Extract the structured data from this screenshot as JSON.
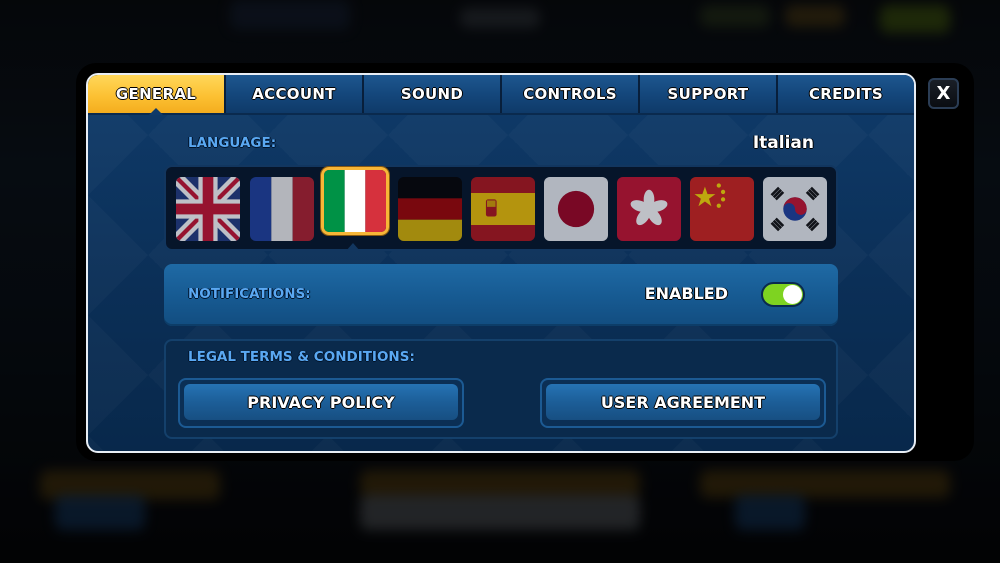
{
  "tabs": [
    {
      "label": "GENERAL",
      "active": true
    },
    {
      "label": "ACCOUNT",
      "active": false
    },
    {
      "label": "SOUND",
      "active": false
    },
    {
      "label": "CONTROLS",
      "active": false
    },
    {
      "label": "SUPPORT",
      "active": false
    },
    {
      "label": "CREDITS",
      "active": false
    }
  ],
  "close_label": "X",
  "language": {
    "label": "LANGUAGE:",
    "selected": "Italian",
    "flags": [
      {
        "name": "uk-flag",
        "language": "English"
      },
      {
        "name": "france-flag",
        "language": "French"
      },
      {
        "name": "italy-flag",
        "language": "Italian"
      },
      {
        "name": "germany-flag",
        "language": "German"
      },
      {
        "name": "spain-flag",
        "language": "Spanish"
      },
      {
        "name": "japan-flag",
        "language": "Japanese"
      },
      {
        "name": "hong-kong-flag",
        "language": "Traditional Chinese"
      },
      {
        "name": "china-flag",
        "language": "Simplified Chinese"
      },
      {
        "name": "korea-flag",
        "language": "Korean"
      }
    ]
  },
  "notifications": {
    "label": "NOTIFICATIONS:",
    "state": "ENABLED",
    "toggle_on": true,
    "toggle_color": "#7ed321"
  },
  "legal": {
    "label": "LEGAL TERMS & CONDITIONS:",
    "privacy_button": "PRIVACY POLICY",
    "agreement_button": "USER AGREEMENT"
  },
  "colors": {
    "accent_active_tab": "#fcc133",
    "label_blue": "#5aa8f2",
    "panel_blue": "#0b2f57"
  }
}
